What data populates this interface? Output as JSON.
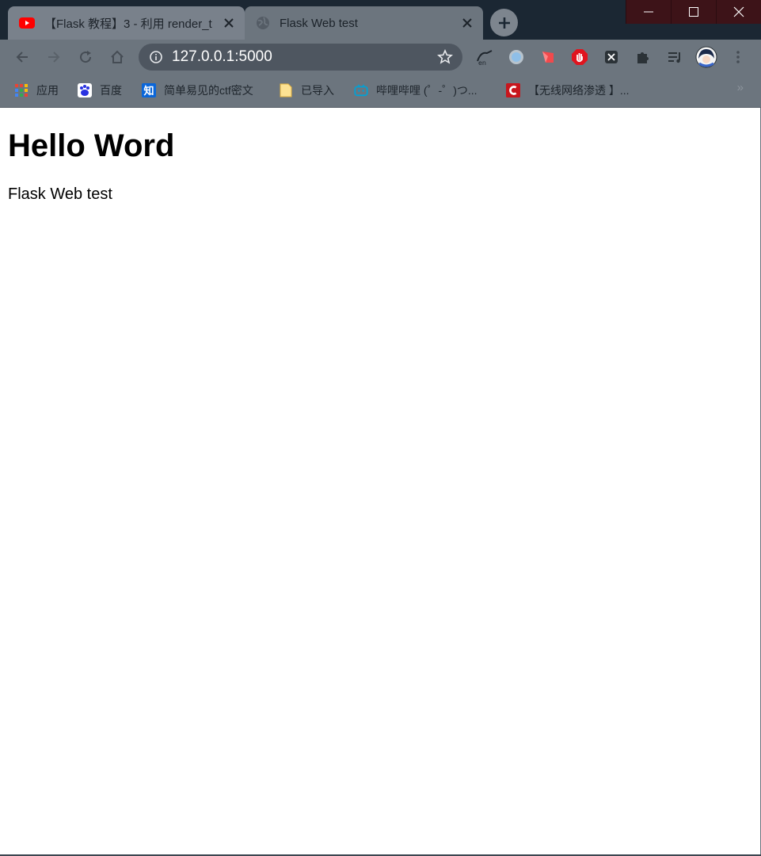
{
  "window": {
    "controls": {
      "minimize": "minimize",
      "maximize": "maximize",
      "close": "close"
    }
  },
  "tabs": [
    {
      "title": "【Flask 教程】3 - 利用 render_t",
      "icon": "youtube-icon",
      "active": false
    },
    {
      "title": "Flask Web test",
      "icon": "globe-icon",
      "active": true
    }
  ],
  "toolbar": {
    "url": "127.0.0.1:5000",
    "extensions": [
      "translate-icon",
      "circle-extension-icon",
      "shape-extension-icon",
      "stop-hand-icon",
      "x-extension-icon",
      "puzzle-icon",
      "reading-list-icon",
      "profile-avatar"
    ]
  },
  "bookmarks": [
    {
      "label": "应用",
      "icon": "apps-grid-icon"
    },
    {
      "label": "百度",
      "icon": "baidu-icon"
    },
    {
      "label": "简单易见的ctf密文",
      "icon": "zhihu-icon"
    },
    {
      "label": "已导入",
      "icon": "folder-icon"
    },
    {
      "label": "哔哩哔哩 (゜-゜)つ...",
      "icon": "bilibili-icon"
    },
    {
      "label": "【无线网络渗透 】...",
      "icon": "csdn-icon"
    }
  ],
  "bookmarks_more": "»",
  "page": {
    "heading": "Hello Word",
    "paragraph": "Flask Web test"
  },
  "colors": {
    "titlebar": "#1b2733",
    "toolbar": "#6c757e",
    "omnibox": "#4e5660",
    "window_controls": "#3d1318"
  }
}
